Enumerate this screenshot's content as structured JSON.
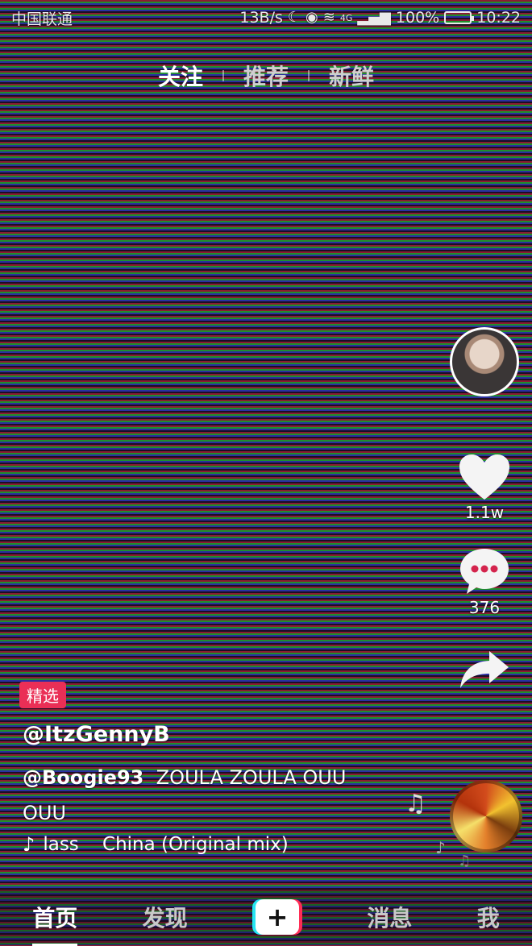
{
  "status_bar": {
    "carrier": "中国联通",
    "network_speed": "13B/s",
    "signal_label": "4G",
    "battery": "100%",
    "time": "10:22"
  },
  "top_tabs": [
    "关注",
    "推荐",
    "新鲜"
  ],
  "right_rail": {
    "likes_count": "1.1w",
    "comments_count": "376"
  },
  "video": {
    "badge": "精选",
    "username": "@ItzGennyB",
    "mention": "@Boogie93",
    "caption_text": "ZOULA ZOULA OUU OUU",
    "music_text": "lass    China (Original mix)"
  },
  "bottom_nav": {
    "home": "首页",
    "discover": "发现",
    "create": "+",
    "messages": "消息",
    "me": "我"
  }
}
